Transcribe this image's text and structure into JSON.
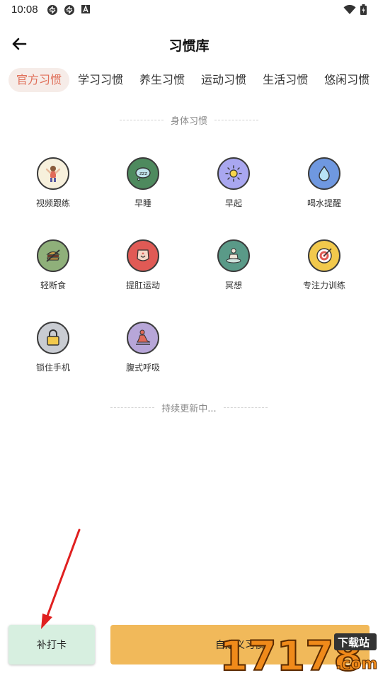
{
  "status_bar": {
    "time": "10:08",
    "left_icons": [
      "sync-icon",
      "sync-icon",
      "font-icon"
    ],
    "right_icons": [
      "wifi-icon",
      "battery-icon"
    ]
  },
  "header": {
    "title": "习惯库",
    "back_icon": "arrow-left-icon"
  },
  "tabs": [
    {
      "label": "官方习惯",
      "active": true
    },
    {
      "label": "学习习惯",
      "active": false
    },
    {
      "label": "养生习惯",
      "active": false
    },
    {
      "label": "运动习惯",
      "active": false
    },
    {
      "label": "生活习惯",
      "active": false
    },
    {
      "label": "悠闲习惯",
      "active": false
    }
  ],
  "section": {
    "title": "身体习惯",
    "footer": "持续更新中..."
  },
  "habits": [
    {
      "name": "视频跟练",
      "icon": "person-exercise-icon",
      "color": "#f7f0dc"
    },
    {
      "name": "早睡",
      "icon": "sleep-cloud-icon",
      "color": "#4e8a5e"
    },
    {
      "name": "早起",
      "icon": "sun-icon",
      "color": "#a9a7f0"
    },
    {
      "name": "喝水提醒",
      "icon": "water-drop-icon",
      "color": "#6f98e0"
    },
    {
      "name": "轻断食",
      "icon": "no-food-icon",
      "color": "#8fb07a"
    },
    {
      "name": "提肛运动",
      "icon": "body-exercise-icon",
      "color": "#e05a55"
    },
    {
      "name": "冥想",
      "icon": "meditation-icon",
      "color": "#5a9a88"
    },
    {
      "name": "专注力训练",
      "icon": "target-icon",
      "color": "#f2c94c"
    },
    {
      "name": "锁住手机",
      "icon": "lock-icon",
      "color": "#c9ccd2"
    },
    {
      "name": "腹式呼吸",
      "icon": "breathing-icon",
      "color": "#b7a6d8"
    }
  ],
  "bottom": {
    "left_button": "补打卡",
    "right_button": "自定义习惯"
  },
  "watermark": {
    "text": "17178",
    "domain": ".com",
    "badge": "下载站"
  },
  "colors": {
    "accent": "#e0705a",
    "tab_active_bg": "#f6ece8",
    "left_button_bg": "#d7efe0",
    "right_button_bg": "#f1b95a",
    "arrow": "#e02020"
  }
}
